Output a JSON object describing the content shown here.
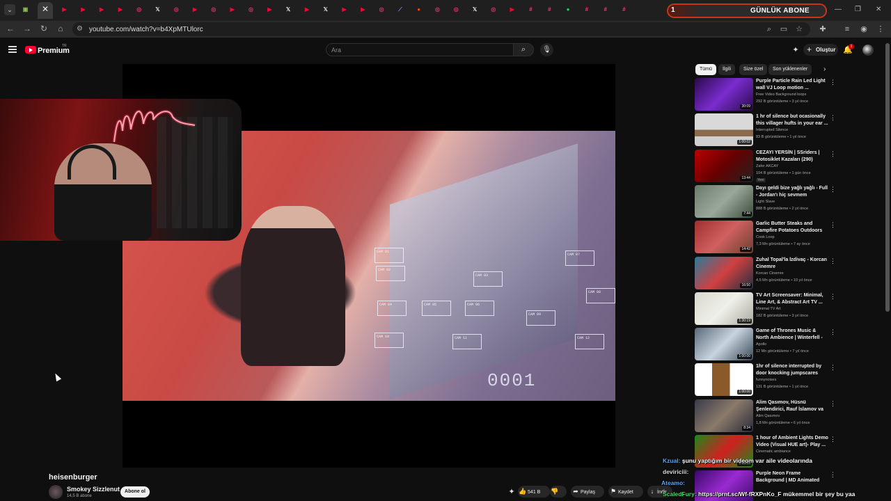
{
  "browser": {
    "tab_favicons": [
      {
        "icon": "youtube-icon",
        "color": "#ff0033",
        "glyph": "▶"
      },
      {
        "icon": "youtube-icon",
        "color": "#ff0033",
        "glyph": "▶"
      },
      {
        "icon": "youtube-icon",
        "color": "#ff0033",
        "glyph": "▶"
      },
      {
        "icon": "youtube-icon",
        "color": "#ff0033",
        "glyph": "▶"
      },
      {
        "icon": "instagram-icon",
        "color": "#e1306c",
        "glyph": "◎"
      },
      {
        "icon": "x-icon",
        "color": "#dddddd",
        "glyph": "𝕏"
      },
      {
        "icon": "instagram-icon",
        "color": "#e1306c",
        "glyph": "◎"
      },
      {
        "icon": "youtube-icon",
        "color": "#ff0033",
        "glyph": "▶"
      },
      {
        "icon": "instagram-icon",
        "color": "#e1306c",
        "glyph": "◎"
      },
      {
        "icon": "youtube-icon",
        "color": "#ff0033",
        "glyph": "▶"
      },
      {
        "icon": "instagram-icon",
        "color": "#e1306c",
        "glyph": "◎"
      },
      {
        "icon": "youtube-icon",
        "color": "#ff0033",
        "glyph": "▶"
      },
      {
        "icon": "x-icon",
        "color": "#dddddd",
        "glyph": "𝕏"
      },
      {
        "icon": "youtube-icon",
        "color": "#ff0033",
        "glyph": "▶"
      },
      {
        "icon": "x-icon",
        "color": "#dddddd",
        "glyph": "𝕏"
      },
      {
        "icon": "youtube-icon",
        "color": "#ff0033",
        "glyph": "▶"
      },
      {
        "icon": "youtube-icon",
        "color": "#ff0033",
        "glyph": "▶"
      },
      {
        "icon": "instagram-icon",
        "color": "#e1306c",
        "glyph": "◎"
      },
      {
        "icon": "feather-icon",
        "color": "#9b8cff",
        "glyph": "⟋"
      },
      {
        "icon": "reddit-icon",
        "color": "#ff4500",
        "glyph": "●"
      },
      {
        "icon": "instagram-icon",
        "color": "#e1306c",
        "glyph": "◎"
      },
      {
        "icon": "instagram-icon",
        "color": "#e1306c",
        "glyph": "◎"
      },
      {
        "icon": "x-icon",
        "color": "#dddddd",
        "glyph": "𝕏"
      },
      {
        "icon": "instagram-icon",
        "color": "#e1306c",
        "glyph": "◎"
      },
      {
        "icon": "youtube-icon",
        "color": "#ff0033",
        "glyph": "▶"
      },
      {
        "icon": "hashtag-icon",
        "color": "#e4407b",
        "glyph": "#"
      },
      {
        "icon": "hashtag-icon",
        "color": "#e4407b",
        "glyph": "#"
      },
      {
        "icon": "spotify-icon",
        "color": "#1ed760",
        "glyph": "●"
      },
      {
        "icon": "hashtag-icon",
        "color": "#e4407b",
        "glyph": "#"
      },
      {
        "icon": "hashtag-icon",
        "color": "#e4407b",
        "glyph": "#"
      },
      {
        "icon": "hashtag-icon",
        "color": "#e4407b",
        "glyph": "#"
      }
    ],
    "abone_widget": {
      "count": "1",
      "label": "GÜNLÜK ABONE",
      "color": "#c8341e"
    },
    "url": "youtube.com/watch?v=b4XpMTUlorc"
  },
  "youtube": {
    "logo_text": "Premium",
    "region": "TR",
    "search_placeholder": "Ara",
    "create_label": "Oluştur",
    "notification_count": "1"
  },
  "video": {
    "title": "heisenburger",
    "channel_name": "Smokey Sizzlenut",
    "channel_subs": "14,5 B abone",
    "subscribe_label": "Abone ol",
    "like_count": "541 B",
    "share_label": "Paylaş",
    "save_label": "Kaydet",
    "download_label": "İndir",
    "hud_code": "0001",
    "hud_labels": [
      "CAM 01",
      "CAM 02",
      "CAM 03",
      "CAM 04",
      "CAM 05",
      "CAM 06",
      "CAM 07",
      "CAM 08",
      "CAM 09",
      "CAM 10",
      "CAM 11",
      "CAM 12"
    ]
  },
  "chips": [
    "Tümü",
    "İlgili",
    "Size özel",
    "Son yüklenenler"
  ],
  "recommendations": [
    {
      "title": "Purple Particle Rain Led Light wall VJ Loop motion ...",
      "channel": "Free Video Background loops",
      "meta": "292 B görüntüleme • 3 yıl önce",
      "duration": "30:09",
      "badge": "",
      "thumb": "linear-gradient(135deg,#2a0a4a,#7a2cd0 50%,#2a0a4a)"
    },
    {
      "title": "1 hr of silence but ocasionally this villager hufts in your ear ...",
      "channel": "Interrupted Silence",
      "meta": "83 B görüntüleme • 1 yıl önce",
      "duration": "1:00:02",
      "badge": "",
      "thumb": "linear-gradient(180deg,#d9d9d9 0 50%,#8a6a4a 50% 70%,#cfcfcf 70%)"
    },
    {
      "title": "CEZAYI YERSİN | SSriders | Motosiklet Kazaları (290)",
      "channel": "Zafer AKCAY",
      "meta": "104 B görüntüleme • 1 gün önce",
      "duration": "13:44",
      "badge": "Yeni",
      "thumb": "linear-gradient(135deg,#b00,#600 50%,#222)"
    },
    {
      "title": "Dayı geldi bize yağlı yağlı - Full - Jordan'ı hiç sevmem",
      "channel": "Light Slave",
      "meta": "888 B görüntüleme • 2 yıl önce",
      "duration": "7:44",
      "badge": "",
      "thumb": "linear-gradient(135deg,#6a7a6a,#9aa89a 50%,#3a4a3a)"
    },
    {
      "title": "Garlic Butter Steaks and Campfire Potatoes Outdoors",
      "channel": "Cook Loop",
      "meta": "7,3 Mn görüntüleme • 7 ay önce",
      "duration": "14:42",
      "badge": "",
      "thumb": "linear-gradient(135deg,#a03030,#d06060 50%,#6a4030)"
    },
    {
      "title": "Zuhal Topal'la İzdivaç - Korcan Cinemre",
      "channel": "Korcan Cinemre",
      "meta": "4,5 Mn görüntüleme • 10 yıl önce",
      "duration": "16:50",
      "badge": "",
      "thumb": "linear-gradient(135deg,#2a7a9a,#d04040 50%,#203040)"
    },
    {
      "title": "TV Art Screensaver: Minimal, Line Art, & Abstract Art TV ...",
      "channel": "Minimal TV Art",
      "meta": "182 B görüntüleme • 3 yıl önce",
      "duration": "1:30:19",
      "badge": "",
      "thumb": "linear-gradient(135deg,#d8d8d0,#f0f0ea 50%,#a8a8a0)"
    },
    {
      "title": "Game of Thrones Music & North Ambience | Winterfell - House ...",
      "channel": "Apollo",
      "meta": "12 Mn görüntüleme • 7 yıl önce",
      "duration": "1:00:00",
      "badge": "",
      "thumb": "linear-gradient(135deg,#5a6a7a,#c8d4de 50%,#3a4a5a)"
    },
    {
      "title": "1hr of silence interrupted by door knocking jumpscares",
      "channel": "funnynoises",
      "meta": "131 B görüntüleme • 1 yıl önce",
      "duration": "1:00:00",
      "badge": "",
      "thumb": "linear-gradient(90deg,#fff 0 30%,#8a5a2a 30% 60%,#fff 60%)"
    },
    {
      "title": "Alim Qasımov, Hüsnü Şenlendirici, Rauf İslamov va ...",
      "channel": "Alim Qasımov",
      "meta": "1,8 Mn görüntüleme • 6 yıl önce",
      "duration": "8:34",
      "badge": "",
      "thumb": "linear-gradient(135deg,#3a3a4a,#8a7a6a 50%,#2a2a3a)"
    },
    {
      "title": "1 hour of Ambient Lights Demo Video (Visual HUE art)- Play ...",
      "channel": "Cinematic ambiance",
      "meta": "",
      "duration": "1:03:25",
      "badge": "",
      "thumb": "linear-gradient(135deg,#1a8a1a,#d02020 50%,#1a8a1a)"
    },
    {
      "title": "Purple Neon Frame Background | MD Animated Backgrounds | ...",
      "channel": "",
      "meta": "",
      "duration": "",
      "badge": "",
      "thumb": "linear-gradient(135deg,#3a0a6a,#9a2ad0 50%,#3a0a6a)"
    }
  ],
  "chat": [
    {
      "user": "Kzual:",
      "message": "şunu yaptığım bir videom var aile videolarında",
      "color": "#58a6ff"
    },
    {
      "user": "deviriciii:",
      "message": "",
      "color": "#dddddd"
    },
    {
      "user": "Ateamo:",
      "message": "",
      "color": "#58a6ff"
    },
    {
      "user": "ScaledFury:",
      "message": "https://prnt.sc/Wf-fRXPnKo_F mükemmel bir şey bu yaa",
      "color": "#4ed86b"
    }
  ]
}
